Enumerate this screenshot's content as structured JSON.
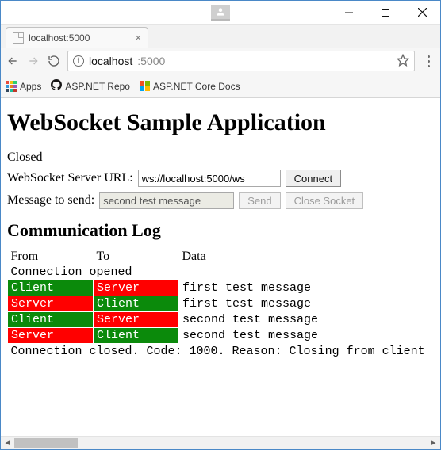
{
  "window": {
    "tab_title": "localhost:5000",
    "url_host": "localhost",
    "url_rest": ":5000"
  },
  "bookmarks": {
    "apps": "Apps",
    "item1": "ASP.NET Repo",
    "item2": "ASP.NET Core Docs"
  },
  "page": {
    "title": "WebSocket Sample Application",
    "status": "Closed",
    "url_label": "WebSocket Server URL:",
    "url_value": "ws://localhost:5000/ws",
    "connect": "Connect",
    "msg_label": "Message to send:",
    "msg_value": "second test message",
    "send": "Send",
    "close_socket": "Close Socket",
    "log_title": "Communication Log",
    "headers": {
      "from": "From",
      "to": "To",
      "data": "Data"
    },
    "opened": "Connection opened",
    "rows": [
      {
        "from": "Client",
        "to": "Server",
        "data": "first test message"
      },
      {
        "from": "Server",
        "to": "Client",
        "data": "first test message"
      },
      {
        "from": "Client",
        "to": "Server",
        "data": "second test message"
      },
      {
        "from": "Server",
        "to": "Client",
        "data": "second test message"
      }
    ],
    "closed": "Connection closed. Code: 1000. Reason: Closing from client"
  }
}
